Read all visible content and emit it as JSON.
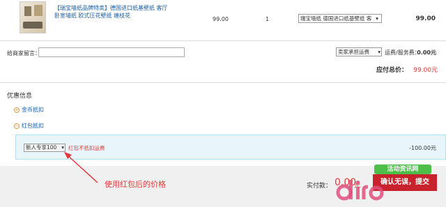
{
  "product": {
    "title": "【瑞宝墙纸品牌特卖】德国进口纸基壁纸 客厅卧室墙纸 欧式压花壁纸 缠枝花",
    "price": "99.00",
    "quantity": "1",
    "spec_selected": "瑞宝墙纸 德国进口纸基壁纸 客",
    "subtotal": "99.00"
  },
  "order": {
    "message_label": "给商家留言：",
    "message_value": "",
    "shipping_option": "卖家承担运费",
    "shipping_label": "运费/服务费：",
    "shipping_value": "0.00元",
    "total_label": "应付总价：",
    "total_value": "99.00元"
  },
  "promotions": {
    "title": "优惠信息",
    "coin_label": "金币抵扣",
    "coin_icon": "+",
    "envelope_label": "红包抵扣",
    "envelope_icon": "−",
    "coupon_selected": "新人专享100",
    "coupon_note": "红包不抵扣运费",
    "coupon_amount": "-100.00元"
  },
  "footer": {
    "annotation": "使用红包后的价格",
    "paid_label": "实付款：",
    "paid_value": "0.00",
    "paid_unit": "元",
    "submit_label": "确认无误，提交"
  },
  "watermark": {
    "badge_text": "活动资讯网"
  },
  "colors": {
    "accent_red": "#e4393c",
    "link_blue": "#1a5fa8",
    "coupon_bg": "#e8f6fb",
    "submit_bg": "#c8232d"
  }
}
